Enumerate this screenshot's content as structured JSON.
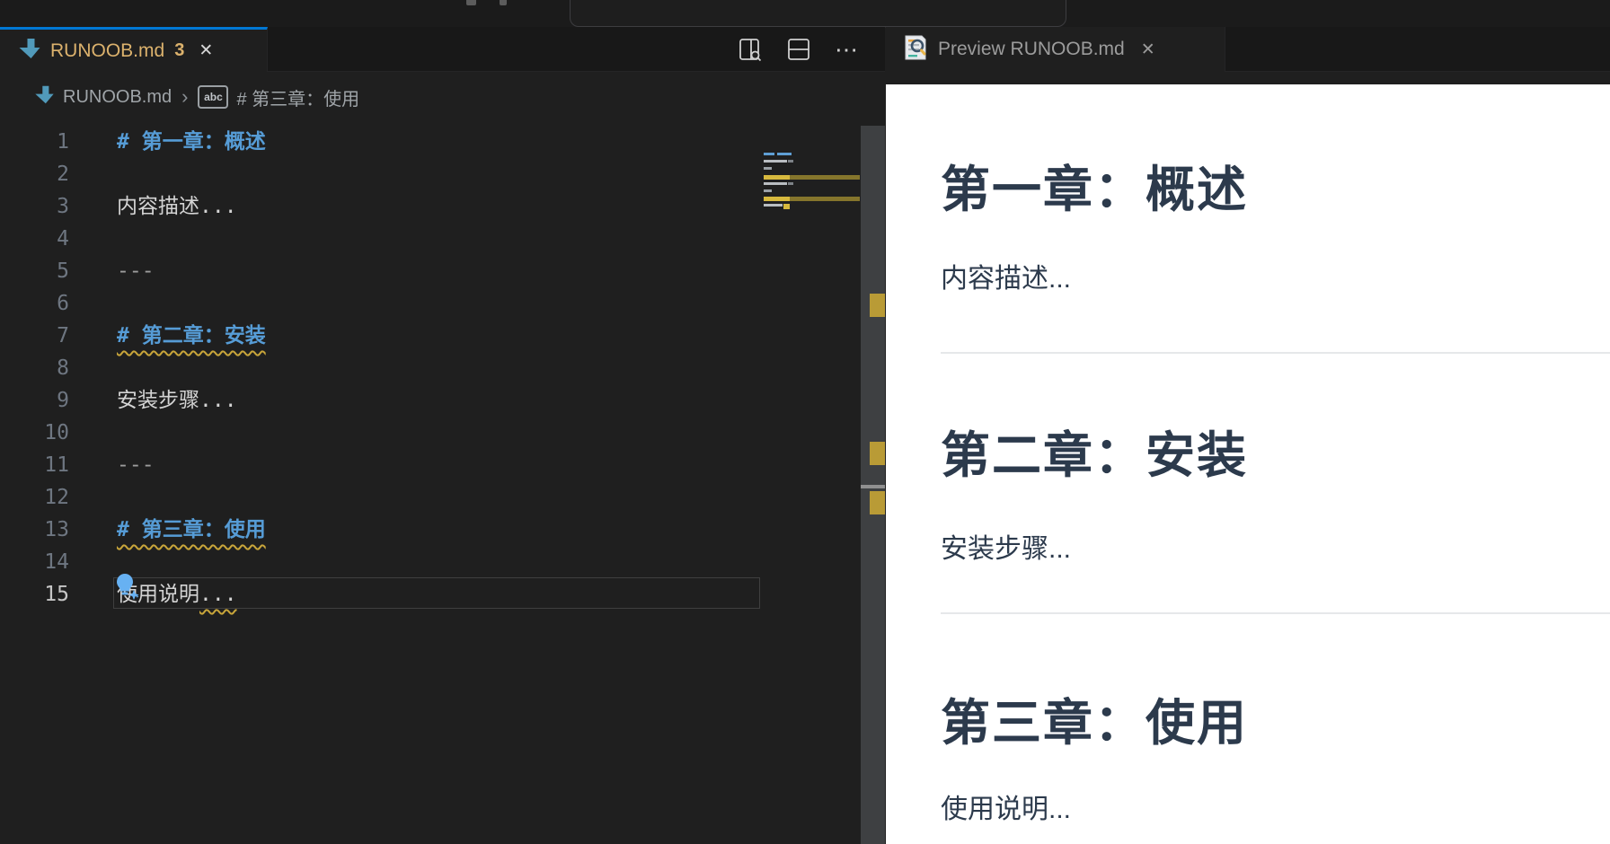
{
  "colors": {
    "accent_blue": "#0078d4",
    "md_heading_blue": "#569cd6",
    "warning_yellow": "#c8a53a",
    "modified_gold": "#dcb26d",
    "editor_bg": "#1f1f1f",
    "tabbar_bg": "#181818",
    "preview_bg": "#ffffff",
    "preview_text": "#2c3a4c"
  },
  "left_editor": {
    "tab": {
      "icon": "markdown-file-icon",
      "label": "RUNOOB.md",
      "badge": "3",
      "close_glyph": "✕"
    },
    "actions": [
      {
        "name": "open-preview-to-side",
        "icon": "preview-side-icon"
      },
      {
        "name": "split-editor",
        "icon": "split-editor-icon"
      },
      {
        "name": "more-actions",
        "glyph": "⋯"
      }
    ],
    "breadcrumb": {
      "icon": "markdown-file-icon",
      "file": "RUNOOB.md",
      "separator": "›",
      "symbol_icon": "abc-symbol-icon",
      "symbol_icon_label": "abc",
      "symbol": "# 第三章：使用"
    },
    "lines": [
      {
        "n": "1",
        "text": "# 第一章：概述",
        "style": "heading"
      },
      {
        "n": "2",
        "text": "",
        "style": "empty"
      },
      {
        "n": "3",
        "text": "内容描述...",
        "style": "text"
      },
      {
        "n": "4",
        "text": "",
        "style": "empty"
      },
      {
        "n": "5",
        "text": "---",
        "style": "rule"
      },
      {
        "n": "6",
        "text": "",
        "style": "empty"
      },
      {
        "n": "7",
        "text": "# 第二章：安装",
        "style": "heading",
        "warning": true
      },
      {
        "n": "8",
        "text": "",
        "style": "empty"
      },
      {
        "n": "9",
        "text": "安装步骤...",
        "style": "text"
      },
      {
        "n": "10",
        "text": "",
        "style": "empty"
      },
      {
        "n": "11",
        "text": "---",
        "style": "rule"
      },
      {
        "n": "12",
        "text": "",
        "style": "empty"
      },
      {
        "n": "13",
        "text": "# 第三章：使用",
        "style": "heading",
        "warning": true
      },
      {
        "n": "14",
        "text": "",
        "style": "empty",
        "lightbulb": true
      },
      {
        "n": "15",
        "text": "使用说明",
        "suffix": "...",
        "style": "text",
        "warning_suffix": true,
        "current": true
      }
    ]
  },
  "preview": {
    "tab": {
      "icon": "markdown-preview-icon",
      "label": "Preview RUNOOB.md",
      "close_glyph": "✕"
    },
    "sections": [
      {
        "type": "h1",
        "text": "第一章：概述"
      },
      {
        "type": "p",
        "text": "内容描述..."
      },
      {
        "type": "hr"
      },
      {
        "type": "h1",
        "text": "第二章：安装"
      },
      {
        "type": "p",
        "text": "安装步骤..."
      },
      {
        "type": "hr"
      },
      {
        "type": "h1",
        "text": "第三章：使用"
      },
      {
        "type": "p",
        "text": "使用说明..."
      }
    ]
  }
}
